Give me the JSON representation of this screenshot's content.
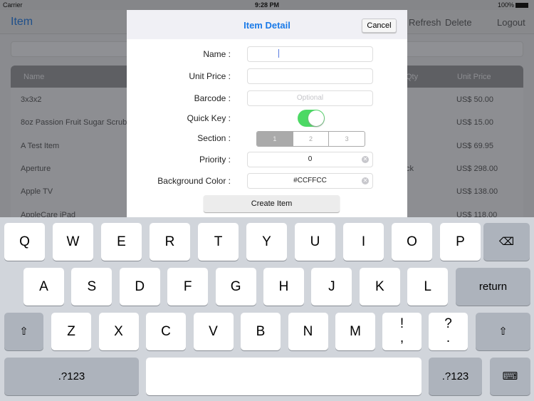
{
  "status": {
    "carrier": "Carrier",
    "time": "9:28 PM",
    "battery": "100%"
  },
  "nav": {
    "title": "Item",
    "refresh": "Refresh",
    "delete": "Delete",
    "logout": "Logout"
  },
  "table": {
    "headers": {
      "name": "Name",
      "qty": "Qty",
      "unit_price": "Unit Price"
    },
    "rows": [
      {
        "name": "3x3x2",
        "qty": "",
        "price": "US$ 50.00"
      },
      {
        "name": "8oz Passion Fruit Sugar Scrub",
        "qty": "",
        "price": "US$ 15.00"
      },
      {
        "name": "A Test Item",
        "qty": "",
        "price": "US$ 69.95"
      },
      {
        "name": "Aperture",
        "qty": "ck",
        "price": "US$ 298.00"
      },
      {
        "name": "Apple TV",
        "qty": "",
        "price": "US$ 138.00"
      },
      {
        "name": "AppleCare iPad",
        "qty": "",
        "price": "US$ 118.00"
      }
    ]
  },
  "modal": {
    "title": "Item Detail",
    "cancel": "Cancel",
    "labels": {
      "name": "Name :",
      "unit_price": "Unit Price :",
      "barcode": "Barcode :",
      "quick_key": "Quick Key :",
      "section": "Section :",
      "priority": "Priority :",
      "bg_color": "Background Color :"
    },
    "fields": {
      "name": "",
      "unit_price": "",
      "barcode_placeholder": "Optional",
      "priority": "0",
      "bg_color": "#CCFFCC"
    },
    "quick_key_on": true,
    "sections": [
      "1",
      "2",
      "3"
    ],
    "selected_section": "1",
    "create": "Create Item",
    "accent": "#1a7ae8",
    "toggle_color": "#4cd964"
  },
  "keyboard": {
    "row1": [
      "Q",
      "W",
      "E",
      "R",
      "T",
      "Y",
      "U",
      "I",
      "O",
      "P"
    ],
    "row2": [
      "A",
      "S",
      "D",
      "F",
      "G",
      "H",
      "J",
      "K",
      "L"
    ],
    "row3": [
      "Z",
      "X",
      "C",
      "V",
      "B",
      "N",
      "M"
    ],
    "excl": "!\n,",
    "quest": "?\n.",
    "return": "return",
    "numbers": ".?123",
    "backspace_icon": "⌫",
    "shift_icon": "⇧",
    "hide_icon": "⌨"
  }
}
